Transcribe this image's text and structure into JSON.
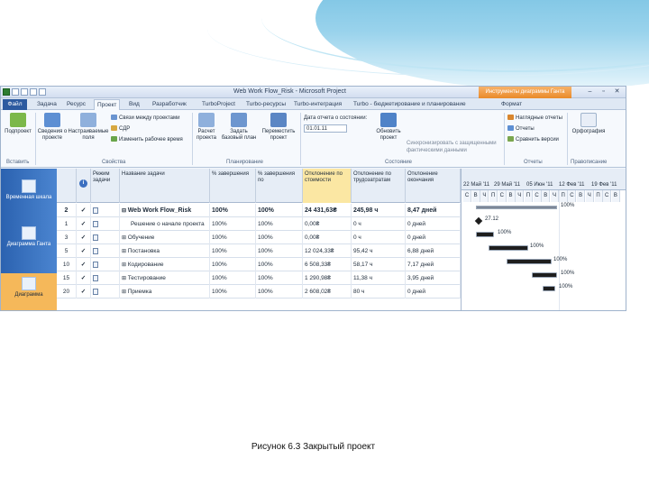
{
  "window": {
    "title": "Web Work Flow_Risk - Microsoft Project",
    "context_tab": "Инструменты диаграммы Ганта",
    "context_subtab": "Формат",
    "controls": [
      "–",
      "▫",
      "✕"
    ]
  },
  "tabs": [
    "Файл",
    "Задача",
    "Ресурс",
    "Проект",
    "Вид",
    "Разработчик",
    "TurboProject",
    "Turbo-ресурсы",
    "Turbo-интеграция",
    "Turbo - бюджетирование и планирование"
  ],
  "ribbon": {
    "subproject": "Подпроект",
    "project_info": "Сведения о проекте",
    "custom_fields": "Настраиваемые поля",
    "links": "Связи между проектами",
    "wbs": "СДР",
    "change_time": "Изменить рабочее время",
    "calc_project": "Расчет проекта",
    "set_baseline": "Задать базовый план",
    "move_project": "Переместить проект",
    "status_date_label": "Дата отчета о состоянии:",
    "status_date": "01.01.11",
    "update_project": "Обновить проект",
    "sync_actual": "Синхронизировать с защищенными фактическими данными",
    "visual_reports": "Наглядные отчеты",
    "reports": "Отчеты",
    "compare_versions": "Сравнить версии",
    "spelling": "Орфография",
    "groups": [
      "Вставить",
      "Свойства",
      "Планирование",
      "Состояние",
      "Отчеты",
      "Правописание"
    ]
  },
  "viewbar": {
    "items": [
      "Временная шкала",
      "Диаграмма Ганта",
      "Диаграмма"
    ]
  },
  "grid": {
    "headers": [
      "Режим задачи",
      "Название задачи",
      "% завершения",
      "% завершения по",
      "Отклонение по стоимости",
      "Отклонение по трудозатратам",
      "Отклонение окончания"
    ],
    "rows": [
      {
        "id": "2",
        "check": "✓",
        "name": "Web Work Flow_Risk",
        "pct": "100%",
        "pct2": "100%",
        "cost": "24 431,63₴",
        "work": "245,98 ч",
        "finish": "8,47 дней",
        "summary": true,
        "toggle": "⊟"
      },
      {
        "id": "1",
        "check": "✓",
        "name": "Решение о начале проекта",
        "pct": "100%",
        "pct2": "100%",
        "cost": "0,00₴",
        "work": "0 ч",
        "finish": "0 дней",
        "summary": false,
        "toggle": ""
      },
      {
        "id": "3",
        "check": "✓",
        "name": "Обучение",
        "pct": "100%",
        "pct2": "100%",
        "cost": "0,00₴",
        "work": "0 ч",
        "finish": "0 дней",
        "summary": false,
        "toggle": "⊞"
      },
      {
        "id": "5",
        "check": "✓",
        "name": "Постановка",
        "pct": "100%",
        "pct2": "100%",
        "cost": "12 024,33₴",
        "work": "95,42 ч",
        "finish": "6,88 дней",
        "summary": false,
        "toggle": "⊞"
      },
      {
        "id": "10",
        "check": "✓",
        "name": "Кодирование",
        "pct": "100%",
        "pct2": "100%",
        "cost": "6 508,33₴",
        "work": "58,17 ч",
        "finish": "7,17 дней",
        "summary": false,
        "toggle": "⊞"
      },
      {
        "id": "15",
        "check": "✓",
        "name": "Тестирование",
        "pct": "100%",
        "pct2": "100%",
        "cost": "1 290,98₴",
        "work": "11,38 ч",
        "finish": "3,95 дней",
        "summary": false,
        "toggle": "⊞"
      },
      {
        "id": "20",
        "check": "✓",
        "name": "Приемка",
        "pct": "100%",
        "pct2": "100%",
        "cost": "2 608,02₴",
        "work": "80 ч",
        "finish": "0 дней",
        "summary": false,
        "toggle": "⊞"
      }
    ]
  },
  "gantt": {
    "months": [
      "22 Май '11",
      "29 Май '11",
      "05 Июн '11",
      "12 Фев '11",
      "19 Фев '11"
    ],
    "days": [
      "С",
      "В",
      "Ч",
      "П",
      "С",
      "В",
      "Ч",
      "П",
      "С",
      "В",
      "Ч",
      "П",
      "С",
      "В",
      "Ч",
      "П",
      "С",
      "В"
    ],
    "labels": {
      "summary": "100%",
      "milestone": "27.12",
      "row3": "100%",
      "row5": "100%",
      "row10": "100%",
      "row15": "100%",
      "row20": "100%"
    }
  },
  "caption": "Рисунок 6.3 Закрытый проект",
  "colors": {
    "file_tab": "#2c5aa0",
    "context": "#e98a2a",
    "viewbar": "#2b62b0",
    "highlight_column": "#fbe7a3"
  }
}
